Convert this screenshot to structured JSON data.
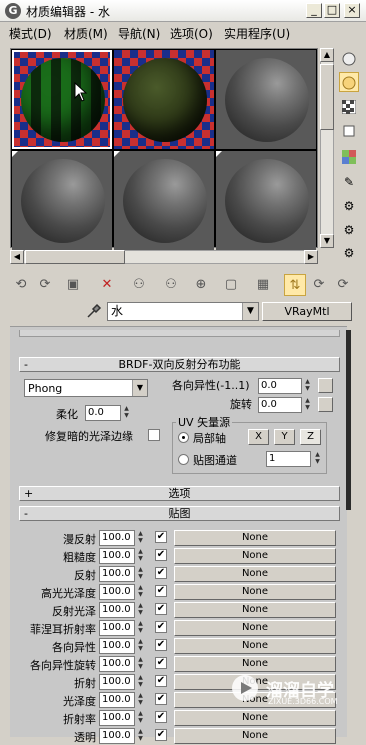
{
  "window": {
    "title": "材质编辑器 - 水",
    "logo_letter": "G",
    "minimize": "_",
    "maximize": "□",
    "close": "×"
  },
  "menu": [
    "模式(D)",
    "材质(M)",
    "导航(N)",
    "选项(O)",
    "实用程序(U)"
  ],
  "material": {
    "name": "水",
    "type": "VRayMtl"
  },
  "brdf": {
    "header": "BRDF-双向反射分布功能",
    "type": "Phong",
    "anisotropy_label": "各向异性(-1..1)",
    "anisotropy_value": "0.0",
    "rotation_label": "旋转",
    "rotation_value": "0.0",
    "soften_label": "柔化",
    "soften_value": "0.0",
    "fix_dark_label": "修复暗的光泽边缘",
    "uv_group_label": "UV 矢量源",
    "local_axis_label": "局部轴",
    "axis_buttons": [
      "X",
      "Y",
      "Z"
    ],
    "map_channel_label": "贴图通道",
    "map_channel_value": "1"
  },
  "rollouts": {
    "options_sign": "+",
    "options": "选项",
    "maps_sign": "-",
    "maps": "贴图",
    "brdf_sign": "-"
  },
  "maps": [
    {
      "label": "漫反射",
      "value": "100.0",
      "checked": "✔",
      "map": "None"
    },
    {
      "label": "粗糙度",
      "value": "100.0",
      "checked": "✔",
      "map": "None"
    },
    {
      "label": "反射",
      "value": "100.0",
      "checked": "✔",
      "map": "None"
    },
    {
      "label": "高光光泽度",
      "value": "100.0",
      "checked": "✔",
      "map": "None"
    },
    {
      "label": "反射光泽",
      "value": "100.0",
      "checked": "✔",
      "map": "None"
    },
    {
      "label": "菲涅耳折射率",
      "value": "100.0",
      "checked": "✔",
      "map": "None"
    },
    {
      "label": "各向异性",
      "value": "100.0",
      "checked": "✔",
      "map": "None"
    },
    {
      "label": "各向异性旋转",
      "value": "100.0",
      "checked": "✔",
      "map": "None"
    },
    {
      "label": "折射",
      "value": "100.0",
      "checked": "✔",
      "map": "None"
    },
    {
      "label": "光泽度",
      "value": "100.0",
      "checked": "✔",
      "map": "None"
    },
    {
      "label": "折射率",
      "value": "100.0",
      "checked": "✔",
      "map": "None"
    },
    {
      "label": "透明",
      "value": "100.0",
      "checked": "✔",
      "map": "None"
    }
  ],
  "watermark": {
    "text": "溜溜自学",
    "url": "ZIXUE.3D66.COM"
  },
  "icons": {
    "dropdown": "▼",
    "scroll_up": "▲",
    "scroll_down": "▼",
    "scroll_left": "◀",
    "scroll_right": "▶"
  }
}
